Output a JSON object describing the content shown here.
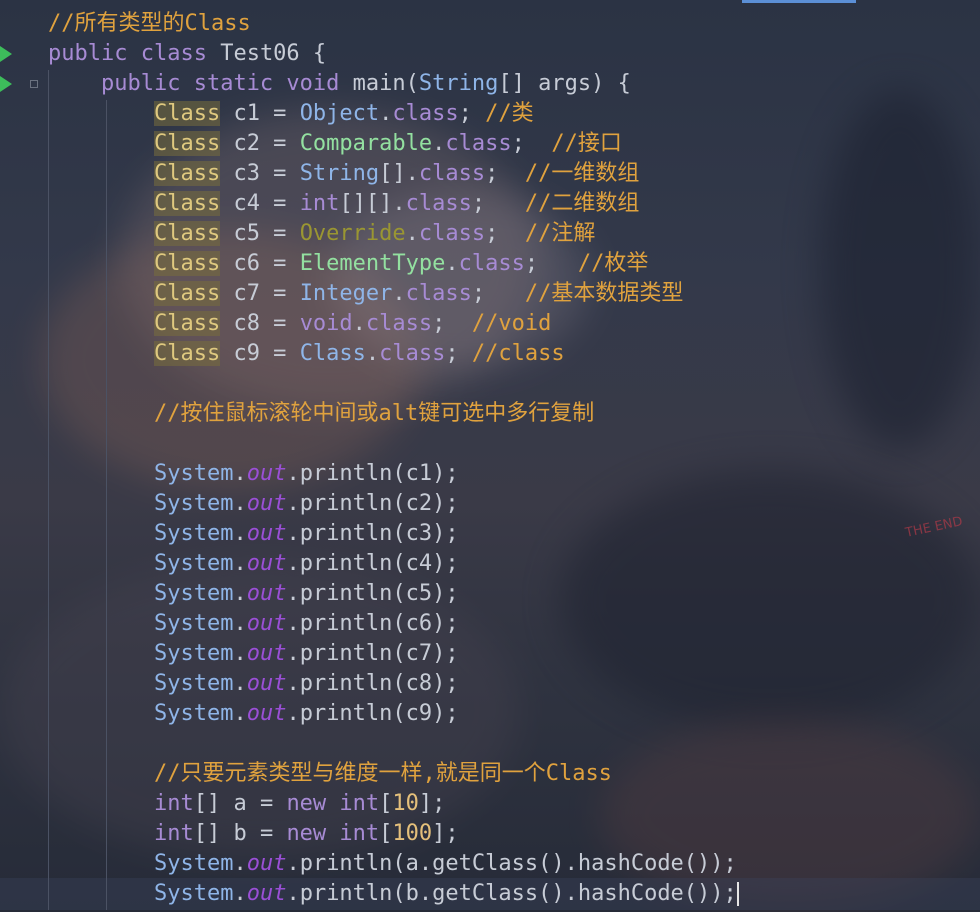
{
  "editor": {
    "lines": [
      {
        "tokens": [
          {
            "t": "//所有类型的Class",
            "c": "cm"
          }
        ]
      },
      {
        "tokens": [
          {
            "t": "public ",
            "c": "kw"
          },
          {
            "t": "class ",
            "c": "kw"
          },
          {
            "t": "Test06 {",
            "c": "ident"
          }
        ]
      },
      {
        "tokens": [
          {
            "t": "    public ",
            "c": "kw"
          },
          {
            "t": "static ",
            "c": "kw"
          },
          {
            "t": "void ",
            "c": "kw"
          },
          {
            "t": "main",
            "c": "ident"
          },
          {
            "t": "(",
            "c": "op"
          },
          {
            "t": "String",
            "c": "cl"
          },
          {
            "t": "[] args) {",
            "c": "ident"
          }
        ]
      },
      {
        "tokens": [
          {
            "t": "        ",
            "c": "ident"
          },
          {
            "t": "Class",
            "c": "cls-hl"
          },
          {
            "t": " c1 = ",
            "c": "ident"
          },
          {
            "t": "Object",
            "c": "cl"
          },
          {
            "t": ".",
            "c": "op"
          },
          {
            "t": "class",
            "c": "kw"
          },
          {
            "t": "; ",
            "c": "op"
          },
          {
            "t": "//类",
            "c": "cm"
          }
        ]
      },
      {
        "tokens": [
          {
            "t": "        ",
            "c": "ident"
          },
          {
            "t": "Class",
            "c": "cls-hl"
          },
          {
            "t": " c2 = ",
            "c": "ident"
          },
          {
            "t": "Comparable",
            "c": "iface"
          },
          {
            "t": ".",
            "c": "op"
          },
          {
            "t": "class",
            "c": "kw"
          },
          {
            "t": ";  ",
            "c": "op"
          },
          {
            "t": "//接口",
            "c": "cm"
          }
        ]
      },
      {
        "tokens": [
          {
            "t": "        ",
            "c": "ident"
          },
          {
            "t": "Class",
            "c": "cls-hl"
          },
          {
            "t": " c3 = ",
            "c": "ident"
          },
          {
            "t": "String",
            "c": "cl"
          },
          {
            "t": "[].",
            "c": "op"
          },
          {
            "t": "class",
            "c": "kw"
          },
          {
            "t": ";  ",
            "c": "op"
          },
          {
            "t": "//一维数组",
            "c": "cm"
          }
        ]
      },
      {
        "tokens": [
          {
            "t": "        ",
            "c": "ident"
          },
          {
            "t": "Class",
            "c": "cls-hl"
          },
          {
            "t": " c4 = ",
            "c": "ident"
          },
          {
            "t": "int",
            "c": "kw"
          },
          {
            "t": "[][].",
            "c": "op"
          },
          {
            "t": "class",
            "c": "kw"
          },
          {
            "t": ";   ",
            "c": "op"
          },
          {
            "t": "//二维数组",
            "c": "cm"
          }
        ]
      },
      {
        "tokens": [
          {
            "t": "        ",
            "c": "ident"
          },
          {
            "t": "Class",
            "c": "cls-hl"
          },
          {
            "t": " c5 = ",
            "c": "ident"
          },
          {
            "t": "Override",
            "c": "anno"
          },
          {
            "t": ".",
            "c": "op"
          },
          {
            "t": "class",
            "c": "kw"
          },
          {
            "t": ";  ",
            "c": "op"
          },
          {
            "t": "//注解",
            "c": "cm"
          }
        ]
      },
      {
        "tokens": [
          {
            "t": "        ",
            "c": "ident"
          },
          {
            "t": "Class",
            "c": "cls-hl"
          },
          {
            "t": " c6 = ",
            "c": "ident"
          },
          {
            "t": "ElementType",
            "c": "iface"
          },
          {
            "t": ".",
            "c": "op"
          },
          {
            "t": "class",
            "c": "kw"
          },
          {
            "t": ";   ",
            "c": "op"
          },
          {
            "t": "//枚举",
            "c": "cm"
          }
        ]
      },
      {
        "tokens": [
          {
            "t": "        ",
            "c": "ident"
          },
          {
            "t": "Class",
            "c": "cls-hl"
          },
          {
            "t": " c7 = ",
            "c": "ident"
          },
          {
            "t": "Integer",
            "c": "cl"
          },
          {
            "t": ".",
            "c": "op"
          },
          {
            "t": "class",
            "c": "kw"
          },
          {
            "t": ";   ",
            "c": "op"
          },
          {
            "t": "//基本数据类型",
            "c": "cm"
          }
        ]
      },
      {
        "tokens": [
          {
            "t": "        ",
            "c": "ident"
          },
          {
            "t": "Class",
            "c": "cls-hl"
          },
          {
            "t": " c8 = ",
            "c": "ident"
          },
          {
            "t": "void",
            "c": "kw"
          },
          {
            "t": ".",
            "c": "op"
          },
          {
            "t": "class",
            "c": "kw"
          },
          {
            "t": ";  ",
            "c": "op"
          },
          {
            "t": "//void",
            "c": "cm"
          }
        ]
      },
      {
        "tokens": [
          {
            "t": "        ",
            "c": "ident"
          },
          {
            "t": "Class",
            "c": "cls-hl"
          },
          {
            "t": " c9 = ",
            "c": "ident"
          },
          {
            "t": "Class",
            "c": "cl"
          },
          {
            "t": ".",
            "c": "op"
          },
          {
            "t": "class",
            "c": "kw"
          },
          {
            "t": "; ",
            "c": "op"
          },
          {
            "t": "//class",
            "c": "cm"
          }
        ]
      },
      {
        "tokens": []
      },
      {
        "tokens": [
          {
            "t": "        ",
            "c": "ident"
          },
          {
            "t": "//按住鼠标滚轮中间或alt键可选中多行复制",
            "c": "cm"
          }
        ]
      },
      {
        "tokens": []
      },
      {
        "tokens": [
          {
            "t": "        ",
            "c": "ident"
          },
          {
            "t": "System",
            "c": "cl"
          },
          {
            "t": ".",
            "c": "op"
          },
          {
            "t": "out",
            "c": "field"
          },
          {
            "t": ".println(c1);",
            "c": "method"
          }
        ]
      },
      {
        "tokens": [
          {
            "t": "        ",
            "c": "ident"
          },
          {
            "t": "System",
            "c": "cl"
          },
          {
            "t": ".",
            "c": "op"
          },
          {
            "t": "out",
            "c": "field"
          },
          {
            "t": ".println(c2);",
            "c": "method"
          }
        ]
      },
      {
        "tokens": [
          {
            "t": "        ",
            "c": "ident"
          },
          {
            "t": "System",
            "c": "cl"
          },
          {
            "t": ".",
            "c": "op"
          },
          {
            "t": "out",
            "c": "field"
          },
          {
            "t": ".println(c3);",
            "c": "method"
          }
        ]
      },
      {
        "tokens": [
          {
            "t": "        ",
            "c": "ident"
          },
          {
            "t": "System",
            "c": "cl"
          },
          {
            "t": ".",
            "c": "op"
          },
          {
            "t": "out",
            "c": "field"
          },
          {
            "t": ".println(c4);",
            "c": "method"
          }
        ]
      },
      {
        "tokens": [
          {
            "t": "        ",
            "c": "ident"
          },
          {
            "t": "System",
            "c": "cl"
          },
          {
            "t": ".",
            "c": "op"
          },
          {
            "t": "out",
            "c": "field"
          },
          {
            "t": ".println(c5);",
            "c": "method"
          }
        ]
      },
      {
        "tokens": [
          {
            "t": "        ",
            "c": "ident"
          },
          {
            "t": "System",
            "c": "cl"
          },
          {
            "t": ".",
            "c": "op"
          },
          {
            "t": "out",
            "c": "field"
          },
          {
            "t": ".println(c6);",
            "c": "method"
          }
        ]
      },
      {
        "tokens": [
          {
            "t": "        ",
            "c": "ident"
          },
          {
            "t": "System",
            "c": "cl"
          },
          {
            "t": ".",
            "c": "op"
          },
          {
            "t": "out",
            "c": "field"
          },
          {
            "t": ".println(c7);",
            "c": "method"
          }
        ]
      },
      {
        "tokens": [
          {
            "t": "        ",
            "c": "ident"
          },
          {
            "t": "System",
            "c": "cl"
          },
          {
            "t": ".",
            "c": "op"
          },
          {
            "t": "out",
            "c": "field"
          },
          {
            "t": ".println(c8);",
            "c": "method"
          }
        ]
      },
      {
        "tokens": [
          {
            "t": "        ",
            "c": "ident"
          },
          {
            "t": "System",
            "c": "cl"
          },
          {
            "t": ".",
            "c": "op"
          },
          {
            "t": "out",
            "c": "field"
          },
          {
            "t": ".println(c9);",
            "c": "method"
          }
        ]
      },
      {
        "tokens": []
      },
      {
        "tokens": [
          {
            "t": "        ",
            "c": "ident"
          },
          {
            "t": "//只要元素类型与维度一样,就是同一个Class",
            "c": "cm"
          }
        ]
      },
      {
        "tokens": [
          {
            "t": "        ",
            "c": "ident"
          },
          {
            "t": "int",
            "c": "kw"
          },
          {
            "t": "[] a = ",
            "c": "ident"
          },
          {
            "t": "new ",
            "c": "kw"
          },
          {
            "t": "int",
            "c": "kw"
          },
          {
            "t": "[",
            "c": "op"
          },
          {
            "t": "10",
            "c": "num"
          },
          {
            "t": "];",
            "c": "op"
          }
        ]
      },
      {
        "tokens": [
          {
            "t": "        ",
            "c": "ident"
          },
          {
            "t": "int",
            "c": "kw"
          },
          {
            "t": "[] b = ",
            "c": "ident"
          },
          {
            "t": "new ",
            "c": "kw"
          },
          {
            "t": "int",
            "c": "kw"
          },
          {
            "t": "[",
            "c": "op"
          },
          {
            "t": "100",
            "c": "num"
          },
          {
            "t": "];",
            "c": "op"
          }
        ]
      },
      {
        "tokens": [
          {
            "t": "        ",
            "c": "ident"
          },
          {
            "t": "System",
            "c": "cl"
          },
          {
            "t": ".",
            "c": "op"
          },
          {
            "t": "out",
            "c": "field"
          },
          {
            "t": ".println(a.getClass().hashCode());",
            "c": "method"
          }
        ]
      },
      {
        "tokens": [
          {
            "t": "        ",
            "c": "ident"
          },
          {
            "t": "System",
            "c": "cl"
          },
          {
            "t": ".",
            "c": "op"
          },
          {
            "t": "out",
            "c": "field"
          },
          {
            "t": ".println(b.getClass().hashCode());",
            "c": "method"
          }
        ],
        "caret": true
      }
    ],
    "colors": {
      "keyword": "#a78bd4",
      "type": "#8fb5e8",
      "comment": "#e0a23e",
      "interface": "#93e0a0",
      "annotation": "#9a9632",
      "number": "#e5c07b",
      "static_field": "#9a4fd6",
      "run_marker": "#3dbd5b"
    },
    "gutter": {
      "run_icons": [
        "run-class-icon",
        "run-main-icon"
      ]
    }
  },
  "background": {
    "watermark_text": "THE END"
  }
}
